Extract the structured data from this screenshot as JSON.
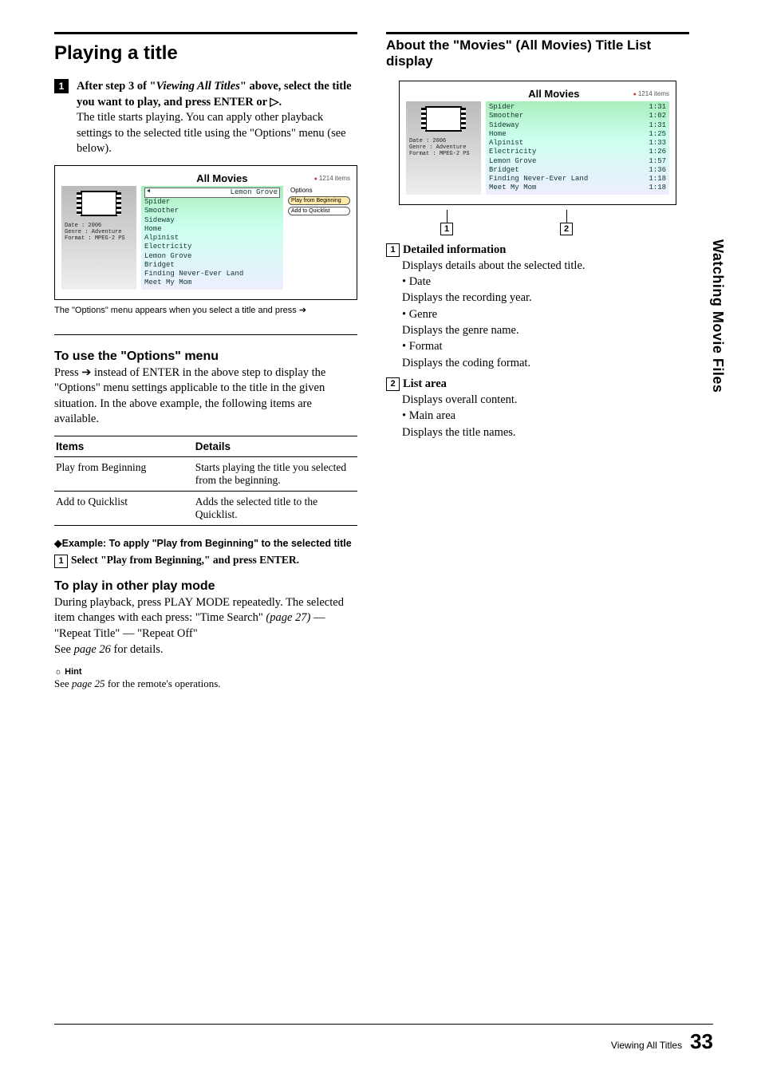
{
  "left": {
    "heading": "Playing a title",
    "step1_badge": "1",
    "step1_lead_a": "After step 3 of \"",
    "step1_lead_em": "Viewing All Titles",
    "step1_lead_b": "\" above, select the title you want to play, and press ENTER or ▷.",
    "step1_body": "The title starts playing. You can apply other playback settings to the selected title using the \"Options\" menu (see below).",
    "shot1": {
      "title": "All Movies",
      "count": "1214 items",
      "meta_date_l": "Date",
      "meta_date_v": ": 2006",
      "meta_genre_l": "Genre",
      "meta_genre_v": ": Adventure",
      "meta_fmt_l": "Format",
      "meta_fmt_v": ": MPEG-2 PS",
      "selected": "Lemon Grove",
      "rows": [
        "Spider",
        "Smoother",
        "Sideway",
        "Home",
        "Alpinist",
        "Electricity",
        "Lemon Grove",
        "Bridget",
        "Finding Never-Ever Land",
        "Meet My Mom"
      ],
      "options_head": "Options",
      "opt1": "Play from Beginning",
      "opt2": "Add to Quicklist"
    },
    "caption1": "The \"Options\" menu appears when you select a title and press ➔",
    "options_heading": "To use the \"Options\" menu",
    "options_body": "Press ➔ instead of ENTER in the above step to display the \"Options\" menu settings applicable to the title in the given situation. In the above example, the following items are available.",
    "table": {
      "h1": "Items",
      "h2": "Details",
      "r1c1": "Play from Beginning",
      "r1c2": "Starts playing the title you selected from the beginning.",
      "r2c1": "Add to Quicklist",
      "r2c2": "Adds the selected title to the Quicklist."
    },
    "example_line": "◆Example: To apply \"Play from Beginning\" to the selected title",
    "ex_step1": "Select \"Play from Beginning,\" and press ENTER.",
    "playmode_heading": "To play in other play mode",
    "playmode_body_a": "During playback, press PLAY MODE repeatedly. The selected item changes with each press: \"Time Search\" ",
    "playmode_body_em1": "(page 27)",
    "playmode_body_b": " — \"Repeat Title\" — \"Repeat Off\"",
    "playmode_see_a": "See ",
    "playmode_see_em": "page 26",
    "playmode_see_b": " for details.",
    "hint_label": "Hint",
    "hint_body_a": "See ",
    "hint_body_em": "page 25",
    "hint_body_b": " for the remote's operations."
  },
  "right": {
    "heading": "About the \"Movies\" (All Movies) Title List display",
    "shot2": {
      "title": "All Movies",
      "count": "1214 items",
      "meta_date_l": "Date",
      "meta_date_v": ": 2006",
      "meta_genre_l": "Genre",
      "meta_genre_v": ": Adventure",
      "meta_fmt_l": "Format",
      "meta_fmt_v": ": MPEG-2 PS",
      "rows": [
        {
          "t": "Spider",
          "d": "1:31"
        },
        {
          "t": "Smoother",
          "d": "1:02"
        },
        {
          "t": "Sideway",
          "d": "1:31"
        },
        {
          "t": "Home",
          "d": "1:25"
        },
        {
          "t": "Alpinist",
          "d": "1:33"
        },
        {
          "t": "Electricity",
          "d": "1:26"
        },
        {
          "t": "Lemon Grove",
          "d": "1:57"
        },
        {
          "t": "Bridget",
          "d": "1:36"
        },
        {
          "t": "Finding Never-Ever Land",
          "d": "1:18"
        },
        {
          "t": "Meet My Mom",
          "d": "1:18"
        }
      ]
    },
    "ptr1": "1",
    "ptr2": "2",
    "d1_head": "Detailed information",
    "d1_a": "Displays details about the selected title.",
    "d1_b_label": "• Date",
    "d1_b": "Displays the recording year.",
    "d1_c_label": "• Genre",
    "d1_c": "Displays the genre name.",
    "d1_d_label": "• Format",
    "d1_d": "Displays the coding format.",
    "d2_head": "List area",
    "d2_a": "Displays overall content.",
    "d2_b_label": "• Main area",
    "d2_b": "Displays the title names."
  },
  "side_tab": "Watching Movie Files",
  "footer_label": "Viewing All Titles",
  "footer_page": "33"
}
